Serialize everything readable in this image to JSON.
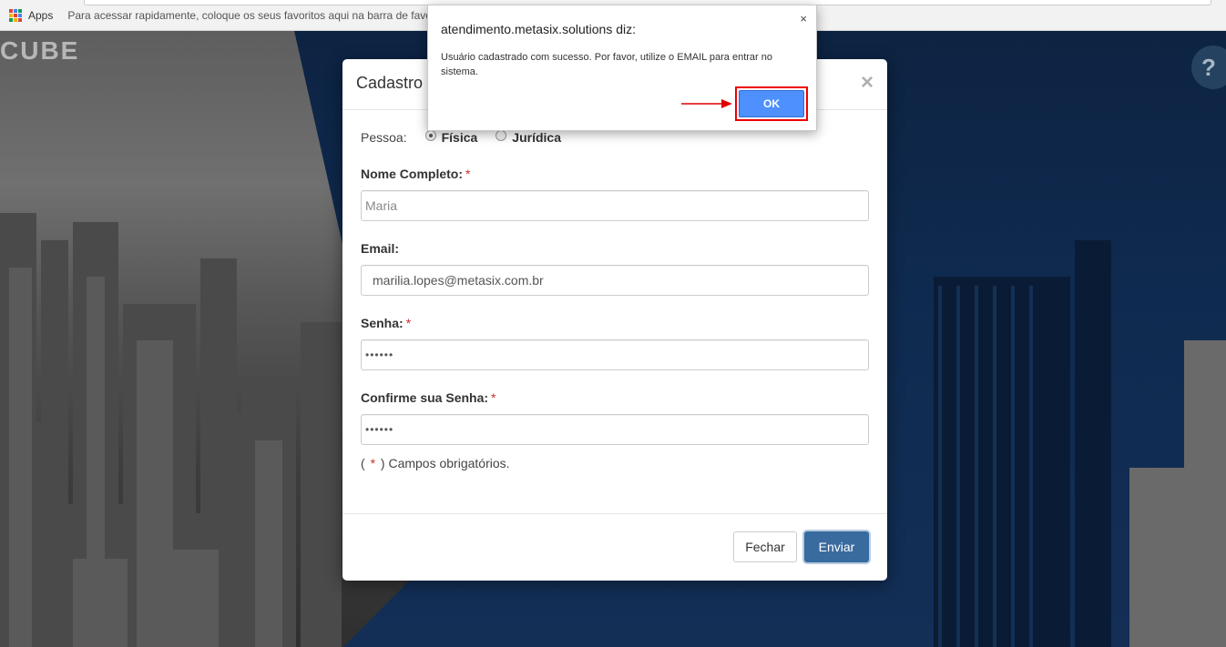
{
  "bookmarks_bar": {
    "apps_label": "Apps",
    "hint": "Para acessar rapidamente, coloque os seus favoritos aqui na barra de favori"
  },
  "background": {
    "brand": "CUBE",
    "help_label": "?"
  },
  "modal": {
    "title": "Cadastro",
    "close_symbol": "×",
    "person_type": {
      "label": "Pessoa:",
      "options": [
        {
          "label": "Física",
          "selected": true
        },
        {
          "label": "Jurídica",
          "selected": false
        }
      ]
    },
    "fields": {
      "full_name": {
        "label": "Nome Completo:",
        "required_mark": "*",
        "value": "Maria"
      },
      "email": {
        "label": "Email:",
        "value": "marilia.lopes@metasix.com.br"
      },
      "password": {
        "label": "Senha:",
        "required_mark": "*",
        "value": "••••••"
      },
      "confirm_password": {
        "label": "Confirme sua Senha:",
        "required_mark": "*",
        "value": "••••••"
      }
    },
    "required_note": {
      "open": "(",
      "mark": "*",
      "close": ") Campos obrigatórios."
    },
    "buttons": {
      "close": "Fechar",
      "send": "Enviar"
    }
  },
  "alert": {
    "title": "atendimento.metasix.solutions diz:",
    "close_symbol": "×",
    "message": "Usuário cadastrado com sucesso. Por favor, utilize o EMAIL para entrar no sistema.",
    "ok_label": "OK",
    "highlight_color": "#e00000"
  }
}
